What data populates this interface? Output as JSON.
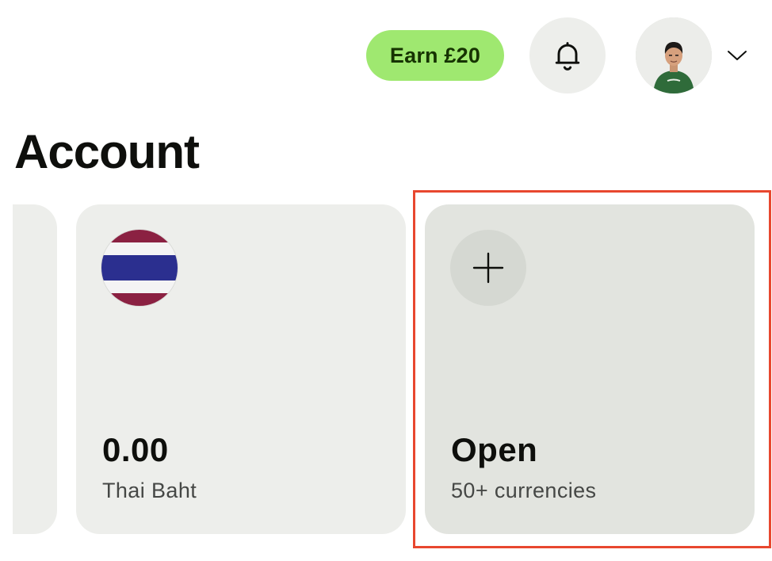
{
  "header": {
    "earn_label": "Earn £20",
    "bell_icon": "bell-icon",
    "avatar_icon": "user-avatar",
    "menu_icon": "chevron-down-icon"
  },
  "page": {
    "title": "Account"
  },
  "cards": [
    {
      "icon": "thailand-flag-icon",
      "amount": "0.00",
      "currency": "Thai Baht"
    },
    {
      "icon": "plus-icon",
      "title": "Open",
      "subtitle": "50+ currencies"
    }
  ],
  "colors": {
    "earn_bg": "#9fe870",
    "earn_text": "#163300",
    "card_bg": "#edeeeb",
    "open_card_bg": "#e2e4df",
    "highlight": "#e8472f",
    "flag_red": "#8b2142",
    "flag_blue": "#2b2f8f"
  }
}
